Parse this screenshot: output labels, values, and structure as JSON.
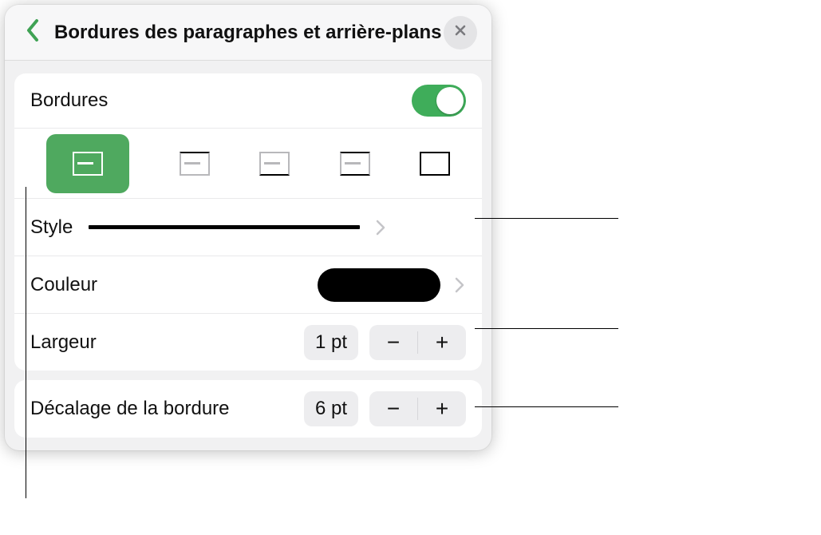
{
  "header": {
    "title": "Bordures des paragraphes et arrière-plans"
  },
  "section": {
    "bordures_label": "Bordures",
    "style_label": "Style",
    "color_label": "Couleur",
    "width_label": "Largeur",
    "width_value": "1 pt",
    "offset_label": "Décalage de la bordure",
    "offset_value": "6 pt"
  },
  "toggle": {
    "on": true
  },
  "colors": {
    "swatch": "#000000",
    "accent": "#4fa95f"
  }
}
